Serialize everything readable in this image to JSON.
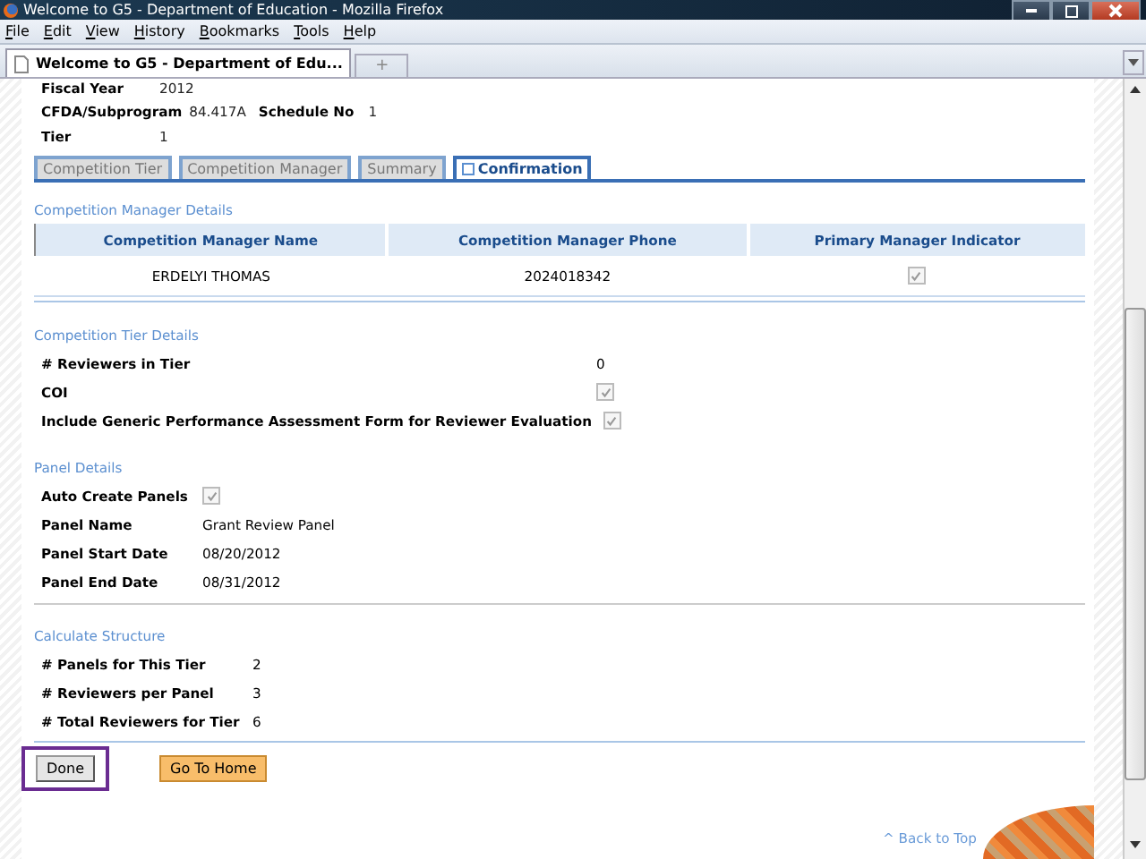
{
  "window": {
    "title": "Welcome to G5 - Department of Education - Mozilla Firefox"
  },
  "menu": [
    {
      "label": "File"
    },
    {
      "label": "Edit"
    },
    {
      "label": "View"
    },
    {
      "label": "History"
    },
    {
      "label": "Bookmarks"
    },
    {
      "label": "Tools"
    },
    {
      "label": "Help"
    }
  ],
  "browser_tabs": [
    {
      "label": "Welcome to G5 - Department of Edu...",
      "selected": true
    }
  ],
  "new_tab": "+",
  "header": {
    "fields": [
      {
        "label": "Fiscal Year",
        "value": "2012"
      },
      {
        "label": "CFDA/Subprogram",
        "value": "84.417A",
        "extra_label": "Schedule No",
        "extra_value": "1"
      },
      {
        "label": "Tier",
        "value": "1"
      }
    ]
  },
  "tabs": [
    {
      "label": "Competition Tier",
      "selected": false
    },
    {
      "label": "Competition Manager",
      "selected": false
    },
    {
      "label": "Summary",
      "selected": false
    },
    {
      "label": "Confirmation",
      "selected": true
    }
  ],
  "manager_section": {
    "title": "Competition Manager Details",
    "columns": [
      "Competition Manager Name",
      "Competition Manager Phone",
      "Primary Manager Indicator"
    ],
    "rows": [
      {
        "name": "ERDELYI THOMAS",
        "phone": "2024018342",
        "primary": true
      }
    ]
  },
  "tier_section": {
    "title": "Competition Tier Details",
    "rows": [
      {
        "label": "# Reviewers in Tier",
        "kind": "text",
        "value": "0"
      },
      {
        "label": "COI",
        "kind": "checkbox",
        "checked": true
      },
      {
        "label": "Include Generic Performance Assessment Form for Reviewer Evaluation",
        "kind": "checkbox",
        "checked": true
      }
    ]
  },
  "panel_section": {
    "title": "Panel Details",
    "rows": [
      {
        "label": "Auto Create Panels",
        "kind": "checkbox",
        "checked": true
      },
      {
        "label": "Panel Name",
        "kind": "text",
        "value": "Grant Review Panel"
      },
      {
        "label": "Panel Start Date",
        "kind": "text",
        "value": "08/20/2012"
      },
      {
        "label": "Panel End Date",
        "kind": "text",
        "value": "08/31/2012"
      }
    ]
  },
  "structure_section": {
    "title": "Calculate Structure",
    "rows": [
      {
        "label": "# Panels for This Tier",
        "value": "2"
      },
      {
        "label": "# Reviewers per Panel",
        "value": "3"
      },
      {
        "label": "# Total Reviewers for Tier",
        "value": "6"
      }
    ]
  },
  "buttons": [
    {
      "label": "Done",
      "kind": "plain",
      "highlighted": true
    },
    {
      "label": "Go To Home",
      "kind": "primary",
      "highlighted": false
    }
  ],
  "back_to_top": "^ Back to Top"
}
